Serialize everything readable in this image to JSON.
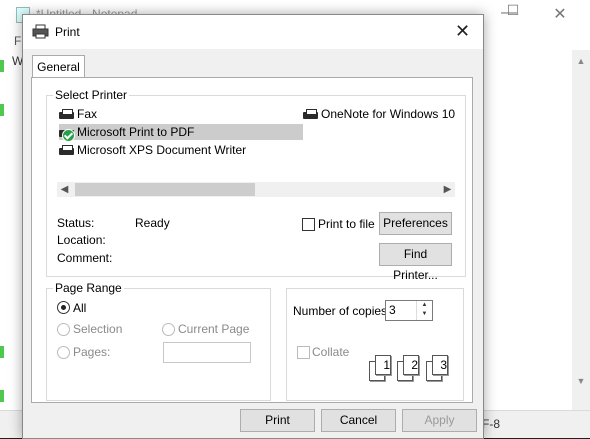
{
  "background_app": {
    "title": "*Untitled - Notepad",
    "menu_text": "Fi",
    "first_line": "We",
    "status_encoding": "F-8"
  },
  "dialog": {
    "title": "Print",
    "close_glyph": "✕",
    "tab_general": "General",
    "select_printer": {
      "title": "Select Printer",
      "printers": [
        {
          "name": "Fax",
          "selected": false,
          "default": false
        },
        {
          "name": "OneNote for Windows 10",
          "selected": false,
          "default": false
        },
        {
          "name": "Microsoft Print to PDF",
          "selected": true,
          "default": true
        },
        {
          "name": "Microsoft XPS Document Writer",
          "selected": false,
          "default": false
        }
      ],
      "status_label": "Status:",
      "status_value": "Ready",
      "location_label": "Location:",
      "location_value": "",
      "comment_label": "Comment:",
      "comment_value": "",
      "print_to_file_label": "Print to file",
      "print_to_file_checked": false,
      "preferences_button": "Preferences",
      "find_printer_button": "Find Printer..."
    },
    "page_range": {
      "title": "Page Range",
      "all_label": "All",
      "selection_label": "Selection",
      "current_page_label": "Current Page",
      "pages_label": "Pages:",
      "pages_value": "",
      "selected_option": "All"
    },
    "copies": {
      "number_label": "Number of copies:",
      "number_value": "3",
      "collate_label": "Collate",
      "collate_checked": false
    },
    "buttons": {
      "print": "Print",
      "cancel": "Cancel",
      "apply": "Apply"
    }
  },
  "colors": {
    "default_printer_badge": "#24a148",
    "selection_highlight": "#cccccc",
    "disabled_text": "#8a8a8a"
  }
}
